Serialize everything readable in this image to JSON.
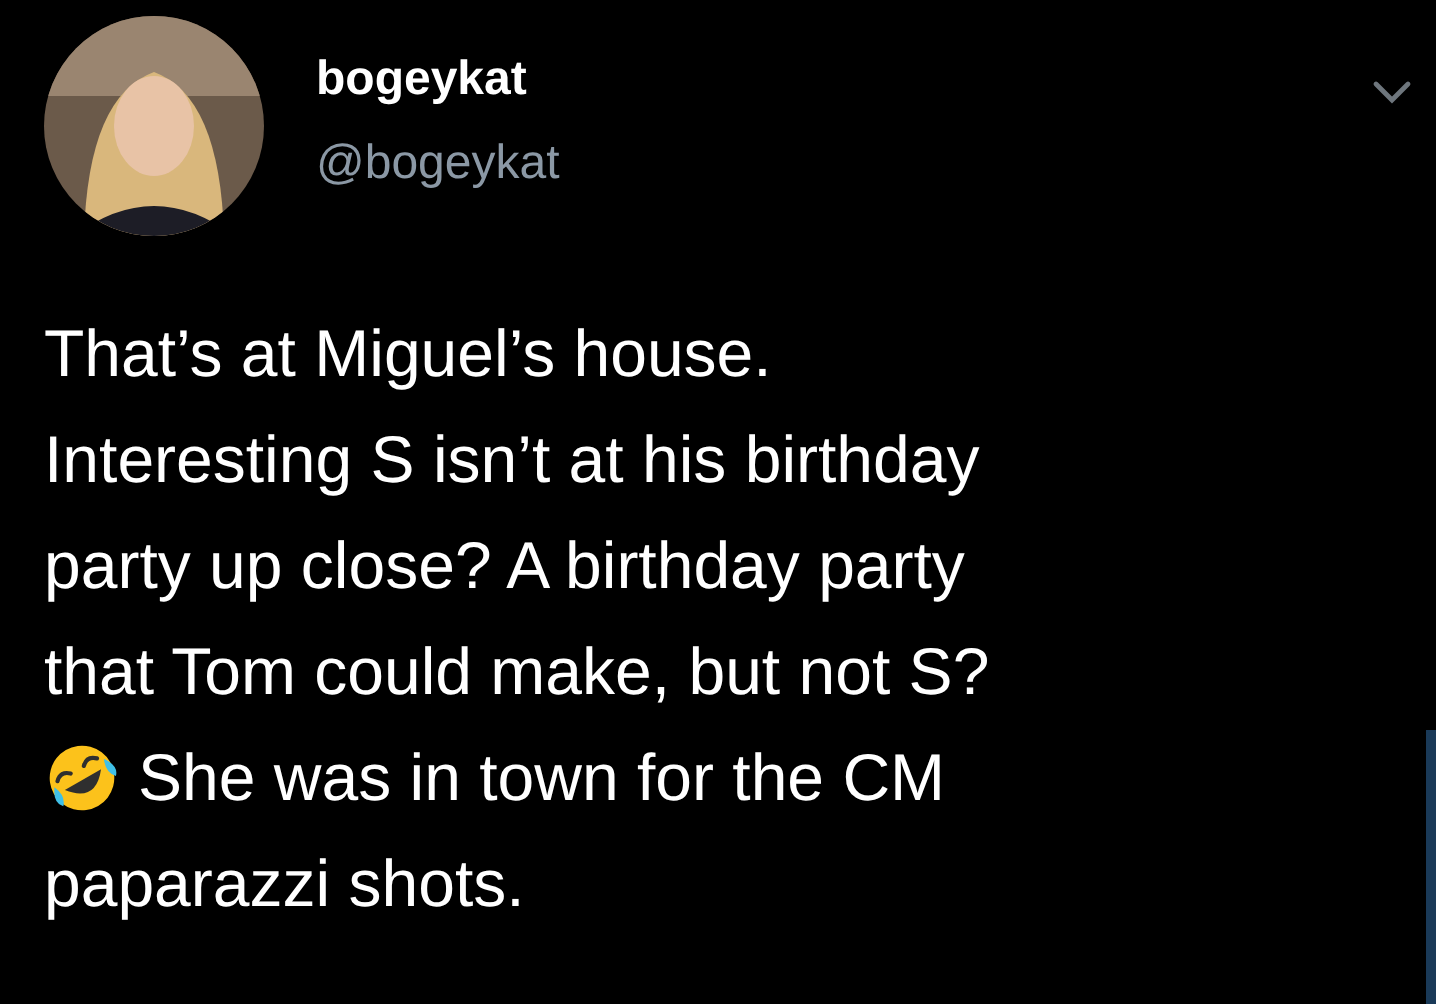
{
  "tweet": {
    "author_name": "bogeykat",
    "handle": "@bogeykat",
    "body_lines": [
      "That’s at Miguel’s house.",
      "Interesting S isn’t at his birthday",
      "party up close? A birthday party",
      "that Tom could make, but not S?"
    ],
    "after_emoji_lines": [
      "She was in town for the CM",
      "paparazzi shots."
    ]
  }
}
